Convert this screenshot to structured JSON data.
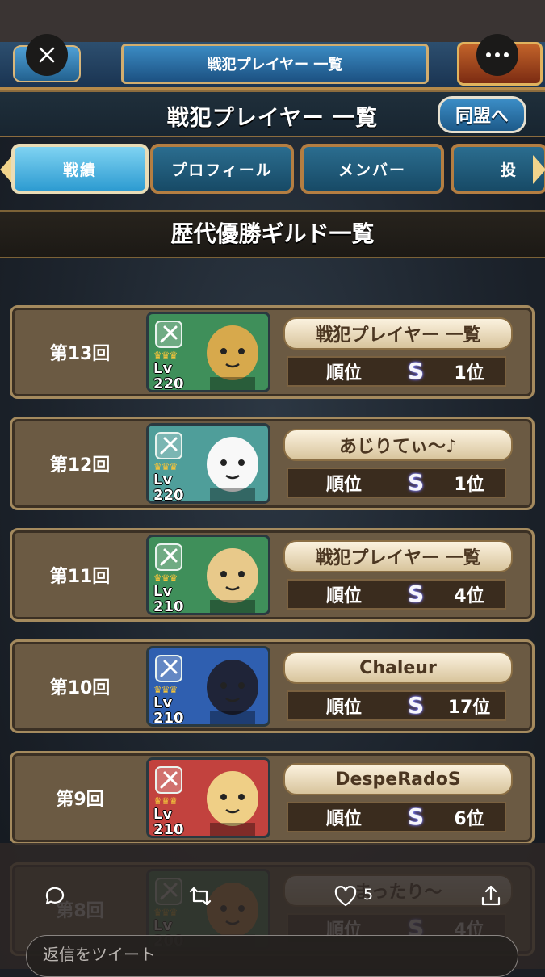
{
  "top_bar": {
    "title": "戦犯プレイヤー 一覧"
  },
  "header": {
    "title": "戦犯プレイヤー 一覧",
    "alliance_button": "同盟へ"
  },
  "tabs": [
    {
      "label": "戦績",
      "active": true
    },
    {
      "label": "プロフィール",
      "active": false
    },
    {
      "label": "メンバー",
      "active": false
    },
    {
      "label": "投",
      "active": false
    }
  ],
  "section_title": "歴代優勝ギルド一覧",
  "rows": [
    {
      "round": "第13回",
      "lv_label": "Lv",
      "level": "220",
      "guild": "戦犯プレイヤー 一覧",
      "rank_label": "順位",
      "grade": "S",
      "rank": "1位",
      "theme": "#3f8f5a",
      "face": "#d7a94c"
    },
    {
      "round": "第12回",
      "lv_label": "Lv",
      "level": "220",
      "guild": "あじりてぃ～♪",
      "rank_label": "順位",
      "grade": "S",
      "rank": "1位",
      "theme": "#4f9e9a",
      "face": "#f8f8f8"
    },
    {
      "round": "第11回",
      "lv_label": "Lv",
      "level": "210",
      "guild": "戦犯プレイヤー 一覧",
      "rank_label": "順位",
      "grade": "S",
      "rank": "4位",
      "theme": "#3f8f5a",
      "face": "#e8c98a"
    },
    {
      "round": "第10回",
      "lv_label": "Lv",
      "level": "210",
      "guild": "Chaleur",
      "rank_label": "順位",
      "grade": "S",
      "rank": "17位",
      "theme": "#2f5fb0",
      "face": "#1f2438"
    },
    {
      "round": "第9回",
      "lv_label": "Lv",
      "level": "210",
      "guild": "DespeRadoS",
      "rank_label": "順位",
      "grade": "S",
      "rank": "6位",
      "theme": "#c2423e",
      "face": "#efcf86"
    },
    {
      "round": "第8回",
      "lv_label": "Lv",
      "level": "200",
      "guild": "まったり～",
      "rank_label": "順位",
      "grade": "S",
      "rank": "4位",
      "theme": "#3f8f5a",
      "face": "#e69a4c"
    }
  ],
  "tweet": {
    "like_count": "5",
    "reply_placeholder": "返信をツイート"
  }
}
